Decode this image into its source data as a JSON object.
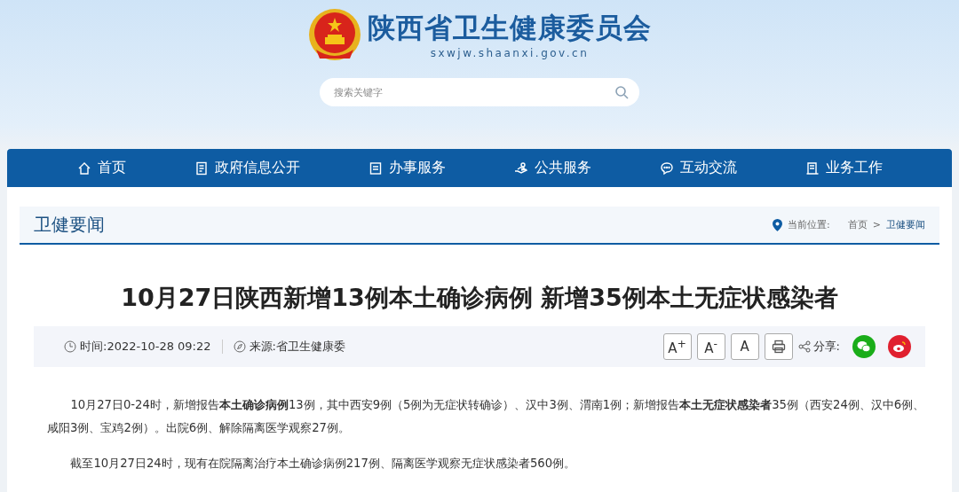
{
  "header": {
    "site_name": "陕西省卫生健康委员会",
    "domain": "sxwjw.shaanxi.gov.cn",
    "search": {
      "placeholder": "搜索关键字"
    }
  },
  "nav": [
    {
      "label": "首页",
      "kind": "home"
    },
    {
      "label": "政府信息公开",
      "kind": "doc"
    },
    {
      "label": "办事服务",
      "kind": "form"
    },
    {
      "label": "公共服务",
      "kind": "hand"
    },
    {
      "label": "互动交流",
      "kind": "chat"
    },
    {
      "label": "业务工作",
      "kind": "book"
    }
  ],
  "section": {
    "title": "卫健要闻",
    "location_label": "当前位置:",
    "breadcrumb": [
      {
        "label": "首页",
        "selected": false
      },
      {
        "label": "卫健要闻",
        "selected": true
      }
    ],
    "separator": ">"
  },
  "article": {
    "title": "10月27日陕西新增13例本土确诊病例 新增35例本土无症状感染者",
    "time": "时间:2022-10-28 09:22",
    "source": "来源:省卫生健康委",
    "font_buttons": [
      "A$^{+}$",
      "A$^{-}$",
      "A"
    ],
    "share_label": "分享:",
    "paragraphs": [
      "10月27日0-24时，新增报告**本土确诊病例**13例，其中西安9例（5例为无症状转确诊）、汉中3例、渭南1例；新增报告**本土无症状感染者**35例（西安24例、汉中6例、咸阳3例、宝鸡2例）。出院6例、解除隔离医学观察27例。",
      "截至10月27日24时，现有在院隔离治疗本土确诊病例217例、隔离医学观察无症状感染者560例。"
    ]
  }
}
